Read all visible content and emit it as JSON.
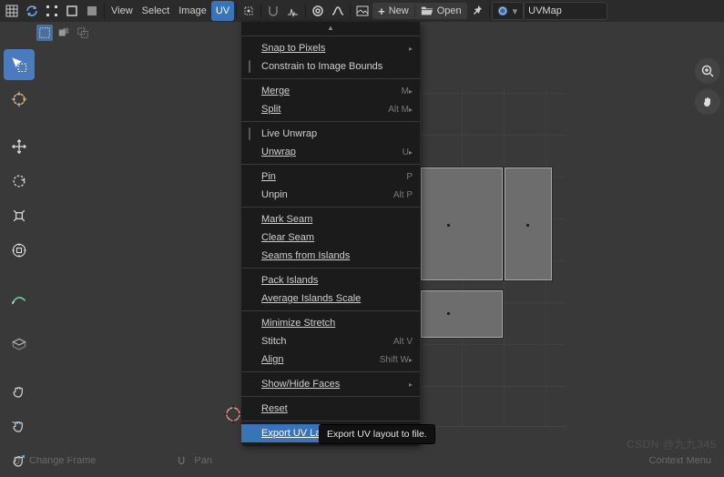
{
  "header": {
    "menus": {
      "view": "View",
      "select": "Select",
      "image": "Image",
      "uv": "UV"
    },
    "new": "New",
    "open": "Open",
    "uvmap": "UVMap"
  },
  "uv_menu": {
    "snap_to_pixels": "Snap to Pixels",
    "constrain": "Constrain to Image Bounds",
    "merge": "Merge",
    "merge_sc": "M",
    "split": "Split",
    "split_sc": "Alt M",
    "live_unwrap": "Live Unwrap",
    "unwrap": "Unwrap",
    "unwrap_sc": "U",
    "pin": "Pin",
    "pin_sc": "P",
    "unpin": "Unpin",
    "unpin_sc": "Alt P",
    "mark_seam": "Mark Seam",
    "clear_seam": "Clear Seam",
    "seams_from_islands": "Seams from Islands",
    "pack_islands": "Pack Islands",
    "average_islands": "Average Islands Scale",
    "minimize_stretch": "Minimize Stretch",
    "stitch": "Stitch",
    "stitch_sc": "Alt V",
    "align": "Align",
    "align_sc": "Shift W",
    "show_hide": "Show/Hide Faces",
    "reset": "Reset",
    "export": "Export UV Layout"
  },
  "tooltip": "Export UV layout to file.",
  "watermark": "CSDN @九九345",
  "status": {
    "change_frame": "Change Frame",
    "pan": "Pan",
    "context_menu": "Context Menu"
  }
}
